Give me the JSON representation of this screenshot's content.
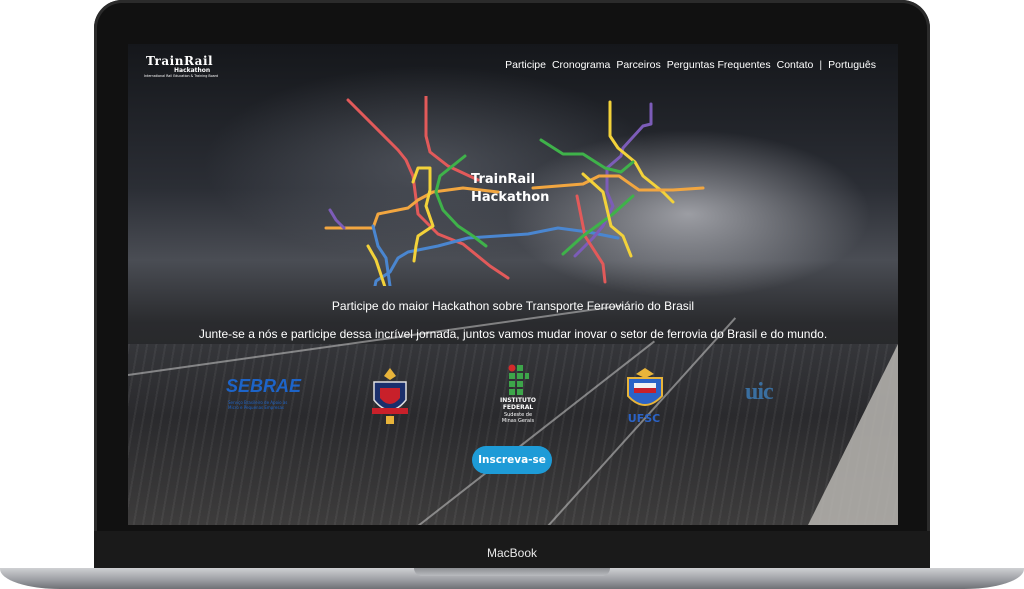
{
  "device": {
    "label": "MacBook"
  },
  "logo": {
    "title": "TrainRail",
    "subtitle": "Hackathon",
    "tagline": "International Rail Education & Training Board"
  },
  "nav": {
    "items": [
      "Participe",
      "Cronograma",
      "Parceiros",
      "Perguntas Frequentes",
      "Contato"
    ],
    "separator": "|",
    "language": "Português"
  },
  "hero": {
    "title_line1": "TrainRail",
    "title_line2": "Hackathon",
    "tagline": "Participe do maior Hackathon sobre Transporte Ferroviário do Brasil",
    "subtagline": "Junte-se a nós e participe dessa incrível jornada, juntos vamos mudar inovar o setor de ferrovia do Brasil e do mundo."
  },
  "partners": {
    "sebrae": {
      "name": "SEBRAE",
      "sub": "Serviço Brasileiro de Apoio às Micro e Pequenas Empresas"
    },
    "ifmg": {
      "line1": "INSTITUTO",
      "line2": "FEDERAL",
      "sub1": "Sudeste de",
      "sub2": "Minas Gerais"
    },
    "ufsc": {
      "name": "UFSC"
    },
    "uic": {
      "name": "uic"
    }
  },
  "cta": {
    "label": "Inscreva-se"
  },
  "colors": {
    "accent": "#1e9bd7",
    "sebrae": "#1d64c8"
  }
}
